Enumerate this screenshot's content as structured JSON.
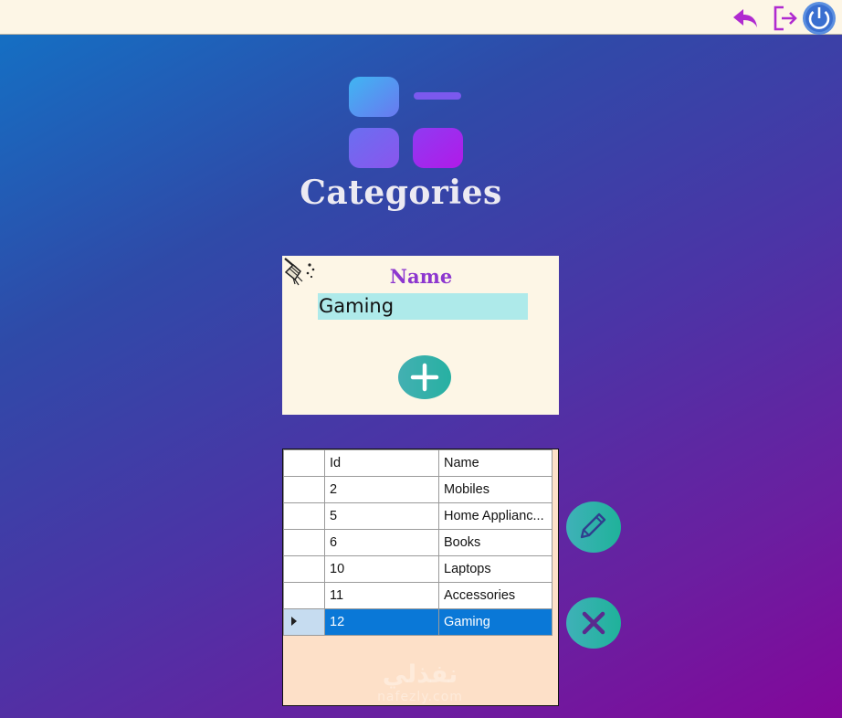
{
  "window": {
    "title": "Categories"
  },
  "toolbar": {
    "back_icon": "back-arrow-icon",
    "logout_icon": "logout-icon",
    "power_icon": "power-icon"
  },
  "page": {
    "title": "Categories",
    "logo_icon": "categories-grid-icon"
  },
  "form": {
    "clear_icon": "broom-icon",
    "name_label": "Name",
    "name_value": "Gaming",
    "add_icon": "plus-icon"
  },
  "grid": {
    "columns": [
      "Id",
      "Name"
    ],
    "rows": [
      {
        "id": "2",
        "name": "Mobiles"
      },
      {
        "id": "5",
        "name": "Home Applianc..."
      },
      {
        "id": "6",
        "name": "Books"
      },
      {
        "id": "10",
        "name": "Laptops"
      },
      {
        "id": "11",
        "name": "Accessories"
      },
      {
        "id": "12",
        "name": "Gaming"
      }
    ],
    "selected_row": 5
  },
  "actions": {
    "edit_icon": "pencil-icon",
    "delete_icon": "close-icon"
  },
  "watermark": {
    "arabic": "نفذلي",
    "latin": "nafezly.com"
  },
  "colors": {
    "topbar_bg": "#fdf6e6",
    "accent_purple": "#8d37cf",
    "teal_button": "#2ab0a4",
    "input_bg": "#aeeaea",
    "selection": "#0a78d7",
    "grid_empty_bg": "#fde0c8"
  }
}
